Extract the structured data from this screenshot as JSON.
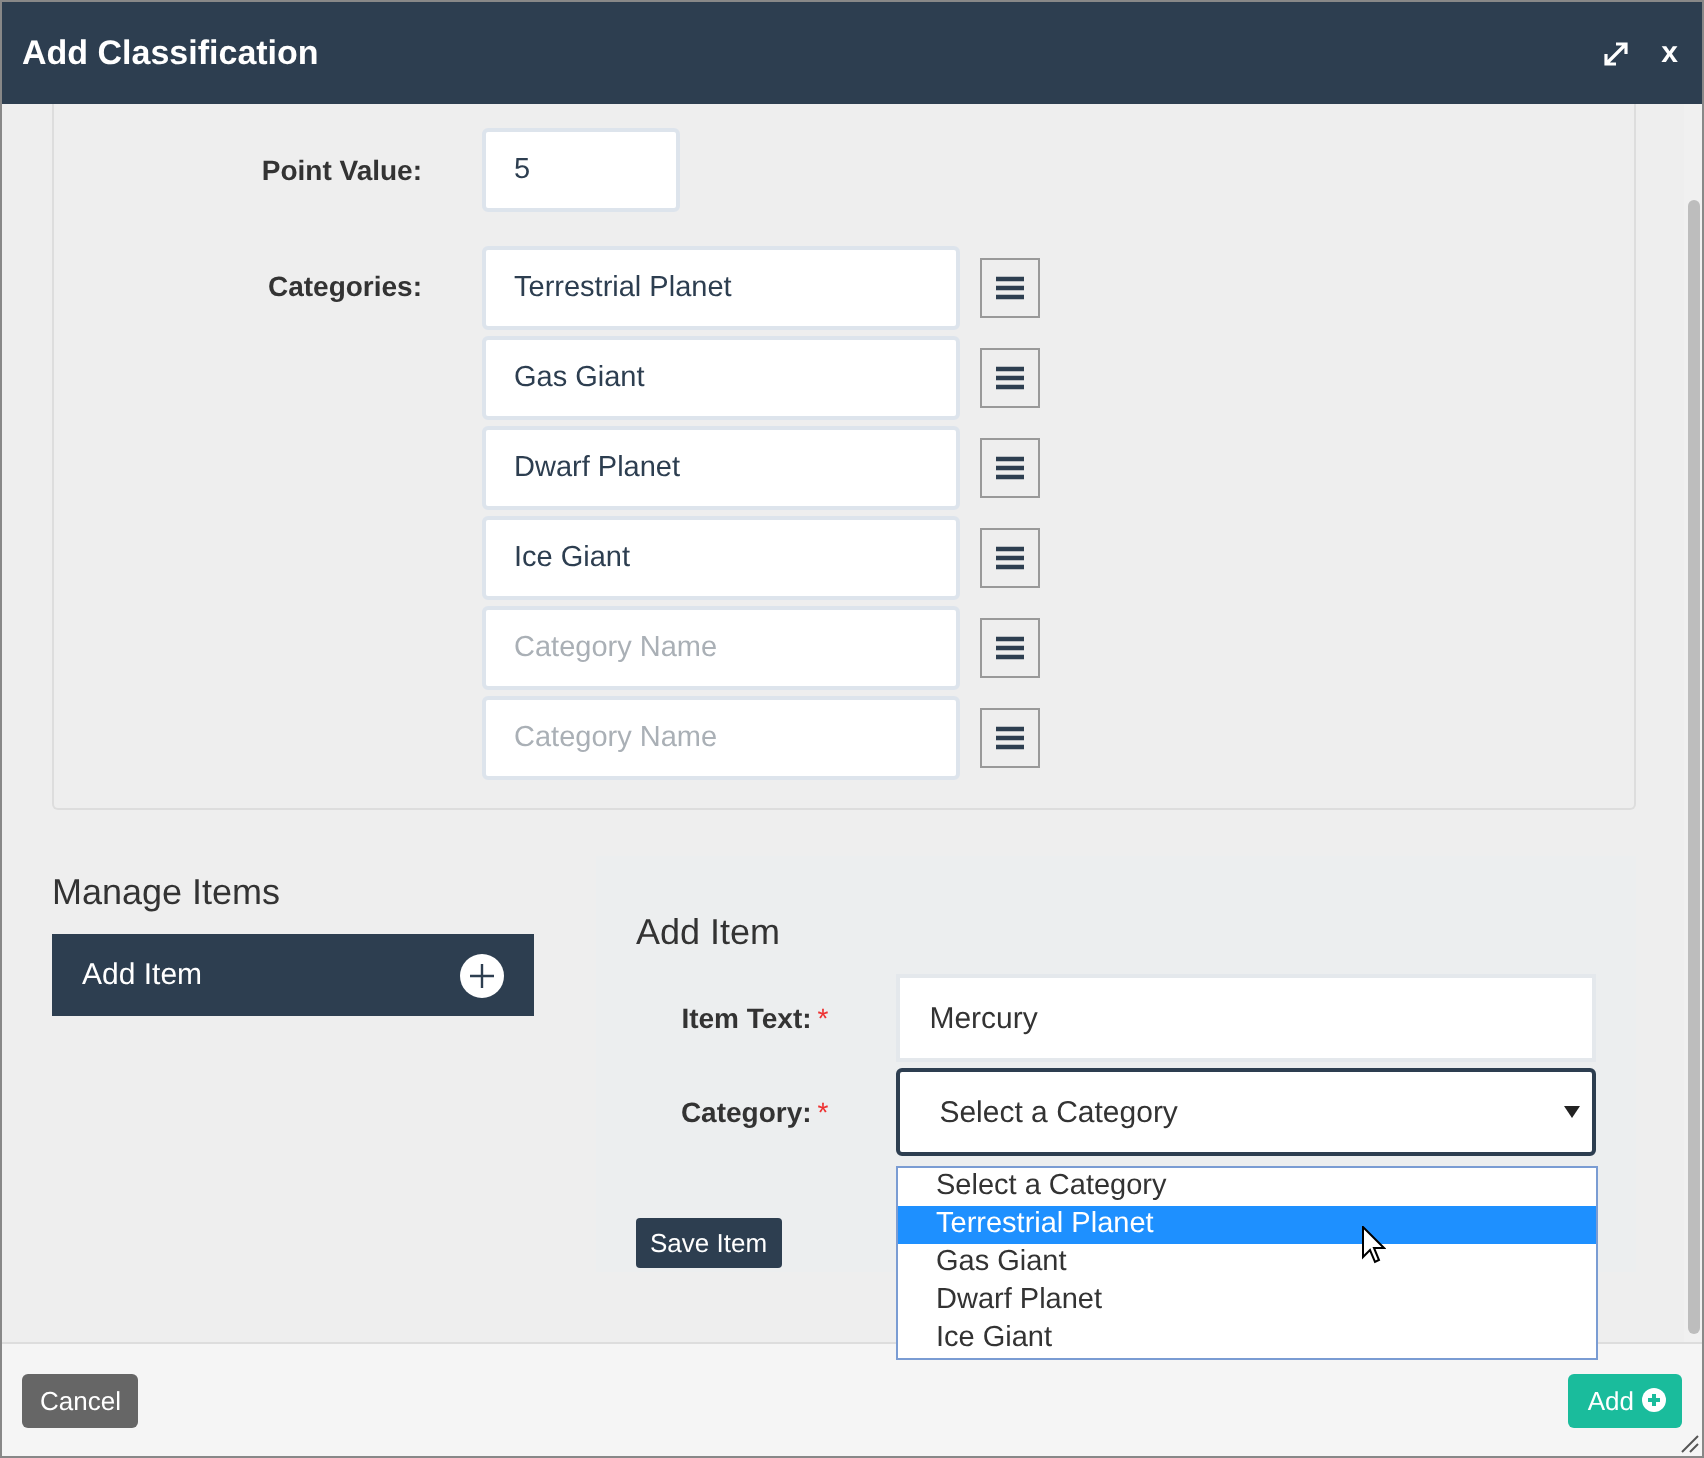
{
  "window": {
    "title": "Add Classification",
    "close_label": "x"
  },
  "point_value": {
    "label": "Point Value:",
    "value": "5"
  },
  "categories": {
    "label": "Categories:",
    "items": [
      {
        "value": "Terrestrial Planet"
      },
      {
        "value": "Gas Giant"
      },
      {
        "value": "Dwarf Planet"
      },
      {
        "value": "Ice Giant"
      },
      {
        "placeholder": "Category Name"
      },
      {
        "placeholder": "Category Name"
      }
    ]
  },
  "manage_items": {
    "title": "Manage Items",
    "items": [
      {
        "label": "Add Item"
      }
    ]
  },
  "add_item": {
    "title": "Add Item",
    "required_mark": "*",
    "fields": [
      {
        "kind": "text",
        "label": "Item Text:",
        "required": true,
        "value": "Mercury"
      },
      {
        "kind": "select",
        "label": "Category:",
        "required": true,
        "value": "Select a Category"
      }
    ],
    "save_label": "Save Item"
  },
  "dropdown": {
    "options": [
      {
        "label": "Select a Category",
        "selected": false
      },
      {
        "label": "Terrestrial Planet",
        "selected": true
      },
      {
        "label": "Gas Giant",
        "selected": false
      },
      {
        "label": "Dwarf Planet",
        "selected": false
      },
      {
        "label": "Ice Giant",
        "selected": false
      }
    ]
  },
  "footer": {
    "cancel_label": "Cancel",
    "add_label": "Add"
  }
}
